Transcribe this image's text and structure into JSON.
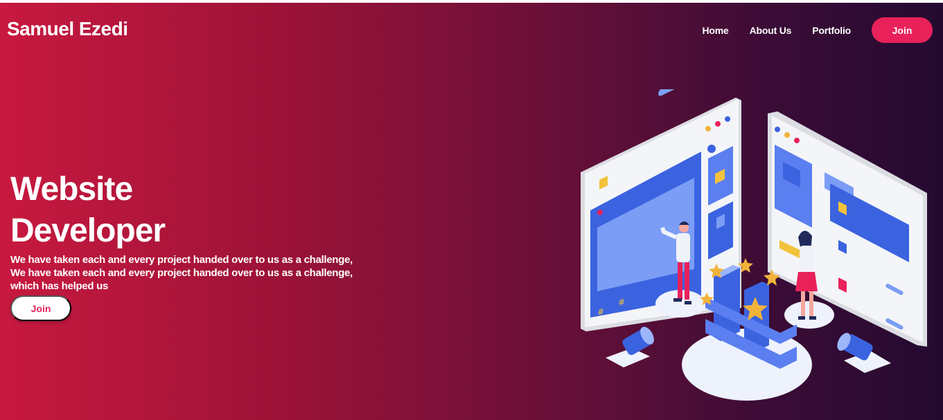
{
  "brand": {
    "name": "Samuel Ezedi"
  },
  "nav": {
    "items": [
      {
        "label": "Home"
      },
      {
        "label": "About Us"
      },
      {
        "label": "Portfolio"
      }
    ],
    "join_label": "Join"
  },
  "hero": {
    "title_line1": "Website",
    "title_line2": "Developer",
    "description_lines": [
      "We have taken each and every project handed over to us as a challenge,",
      "We have taken each and every project handed over to us as a challenge,",
      "which has helped us"
    ],
    "cta_label": "Join"
  },
  "colors": {
    "gradient_start": "#c8193f",
    "gradient_end": "#240a30",
    "accent_pink": "#e8215a",
    "illustration_blue": "#3b63e0"
  },
  "illustration": {
    "icon": "developer-workspace-illustration",
    "symbols": [
      "#",
      "#"
    ]
  }
}
